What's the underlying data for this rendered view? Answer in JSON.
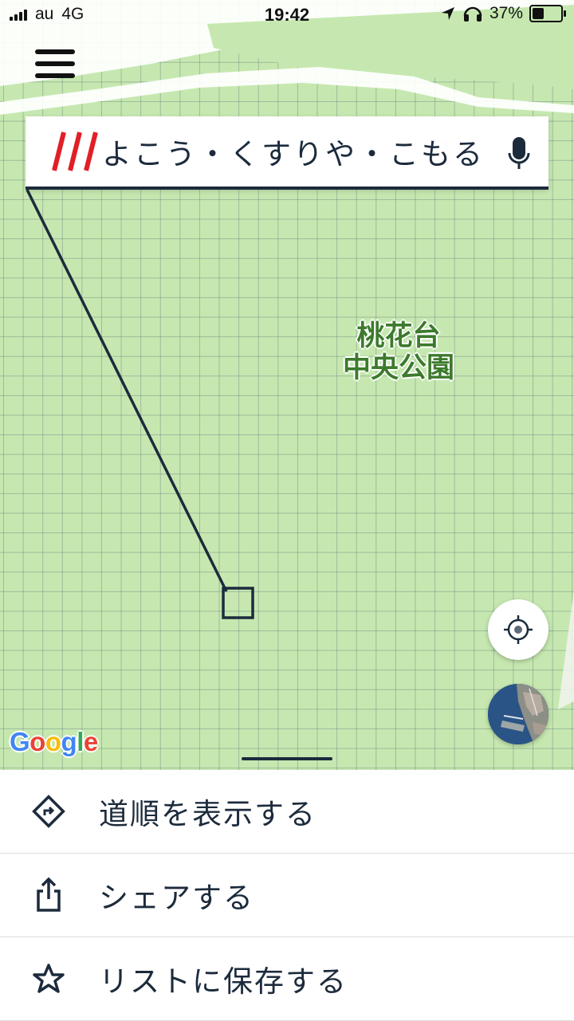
{
  "status_bar": {
    "carrier": "au",
    "network": "4G",
    "time": "19:42",
    "battery_percent": "37%",
    "battery_level": 0.37
  },
  "search": {
    "logo": "///",
    "address": "よこう・くすりや・こもる",
    "mic_icon": "microphone-icon"
  },
  "map": {
    "park_label_line1": "桃花台",
    "park_label_line2": "中央公園",
    "attribution": "Google",
    "marker_icon": "square-marker-icon",
    "locate_icon": "crosshair-icon",
    "satellite_icon": "satellite-thumbnail-icon"
  },
  "sheet": {
    "items": [
      {
        "label": "道順を表示する",
        "icon": "directions-icon"
      },
      {
        "label": "シェアする",
        "icon": "share-icon"
      },
      {
        "label": "リストに保存する",
        "icon": "star-icon"
      }
    ]
  },
  "colors": {
    "park_green": "#c6e8b0",
    "navy": "#1c2b3c",
    "w3w_red": "#e11f26",
    "label_green": "#3c7a2c"
  }
}
